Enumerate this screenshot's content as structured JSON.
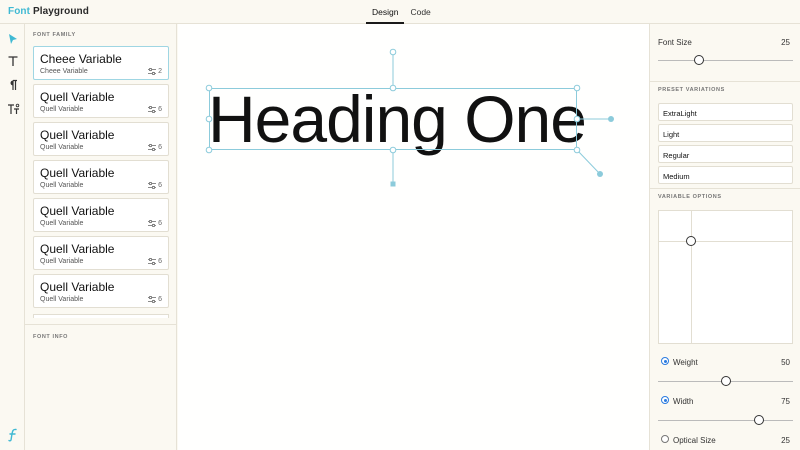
{
  "app": {
    "brand_part1": "Font",
    "brand_part2": "Playground"
  },
  "tabs": [
    {
      "label": "Design",
      "active": true
    },
    {
      "label": "Code",
      "active": false
    }
  ],
  "tools": [
    {
      "name": "select-arrow-icon"
    },
    {
      "name": "text-icon"
    },
    {
      "name": "paragraph-icon"
    },
    {
      "name": "text-style-icon"
    }
  ],
  "sidebar": {
    "family_title": "FONT FAMILY",
    "info_title": "FONT INFO",
    "fonts": [
      {
        "name": "Cheee Variable",
        "sub": "Cheee Variable",
        "count": "2",
        "selected": true
      },
      {
        "name": "Quell Variable",
        "sub": "Quell Variable",
        "count": "6"
      },
      {
        "name": "Quell Variable",
        "sub": "Quell Variable",
        "count": "6"
      },
      {
        "name": "Quell Variable",
        "sub": "Quell Variable",
        "count": "6"
      },
      {
        "name": "Quell Variable",
        "sub": "Quell Variable",
        "count": "6"
      },
      {
        "name": "Quell Variable",
        "sub": "Quell Variable",
        "count": "6"
      },
      {
        "name": "Quell Variable",
        "sub": "Quell Variable",
        "count": "6"
      }
    ]
  },
  "canvas": {
    "text": "Heading One"
  },
  "panel": {
    "font_size_label": "Font Size",
    "font_size_value": "25",
    "font_size_level": 0.3,
    "preset_title": "PRESET VARIATIONS",
    "presets": [
      "ExtraLight",
      "Light",
      "Regular",
      "Medium"
    ],
    "variable_title": "VARIABLE OPTIONS",
    "options": [
      {
        "label": "Weight",
        "value": "50",
        "enabled": true,
        "level": 0.5
      },
      {
        "label": "Width",
        "value": "75",
        "enabled": true,
        "level": 0.75
      },
      {
        "label": "Optical Size",
        "value": "25",
        "enabled": false
      }
    ]
  },
  "colors": {
    "accent": "#3fb9d3",
    "selection": "#8ccbdb",
    "radio_on": "#2a7be0"
  }
}
